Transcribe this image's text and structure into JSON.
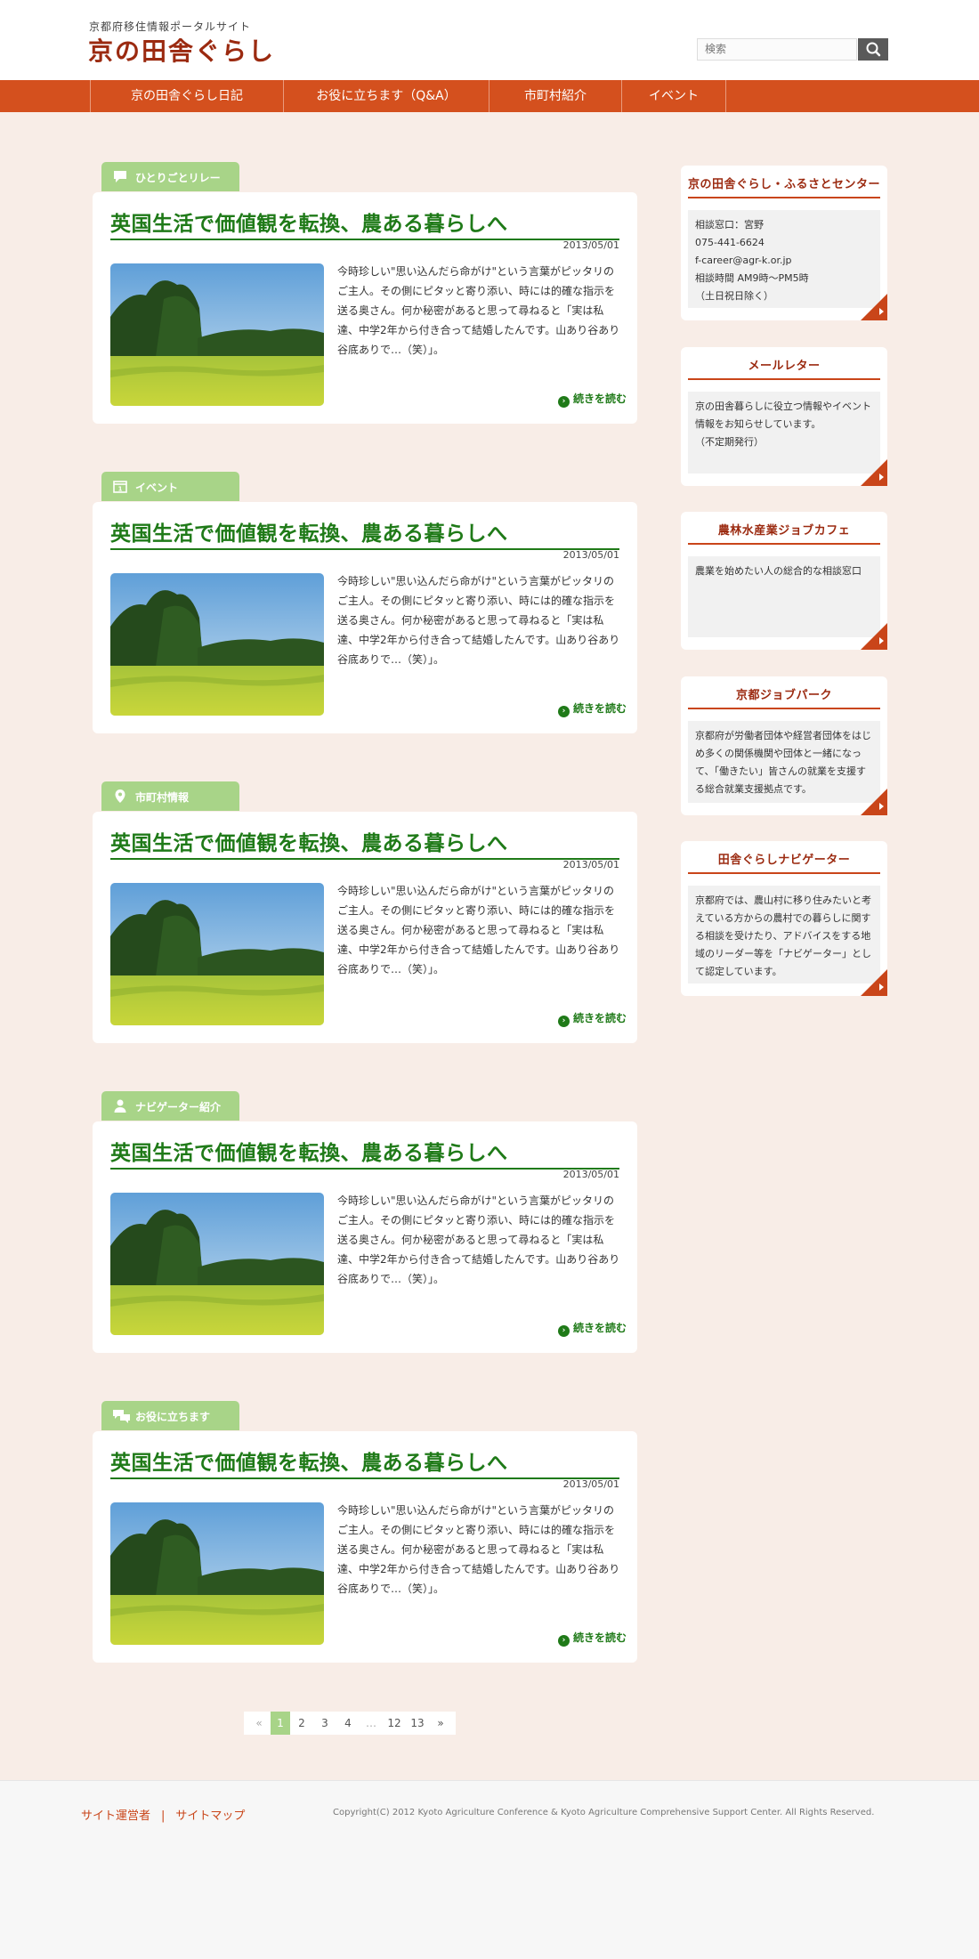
{
  "header": {
    "site_subtitle": "京都府移住情報ポータルサイト",
    "site_title": "京の田舎ぐらし",
    "search_placeholder": "検索"
  },
  "nav": {
    "items": [
      "京の田舎ぐらし日記",
      "お役に立ちます（Q&A）",
      "市町村紹介",
      "イベント"
    ]
  },
  "posts": [
    {
      "category": "ひとりごとリレー",
      "category_icon": "speech-bubble-icon",
      "title": "英国生活で価値観を転換、農ある暮らしへ",
      "date": "2013/05/01",
      "excerpt": "今時珍しい\"思い込んだら命がけ\"という言葉がピッタリのご主人。その側にピタッと寄り添い、時には的確な指示を送る奥さん。何か秘密があると思って尋ねると「実は私達、中学2年から付き合って結婚したんです。山あり谷あり谷底ありで…（笑）」。",
      "more": "続きを読む"
    },
    {
      "category": "イベント",
      "category_icon": "calendar-icon",
      "title": "英国生活で価値観を転換、農ある暮らしへ",
      "date": "2013/05/01",
      "excerpt": "今時珍しい\"思い込んだら命がけ\"という言葉がピッタリのご主人。その側にピタッと寄り添い、時には的確な指示を送る奥さん。何か秘密があると思って尋ねると「実は私達、中学2年から付き合って結婚したんです。山あり谷あり谷底ありで…（笑）」。",
      "more": "続きを読む"
    },
    {
      "category": "市町村情報",
      "category_icon": "map-pin-icon",
      "title": "英国生活で価値観を転換、農ある暮らしへ",
      "date": "2013/05/01",
      "excerpt": "今時珍しい\"思い込んだら命がけ\"という言葉がピッタリのご主人。その側にピタッと寄り添い、時には的確な指示を送る奥さん。何か秘密があると思って尋ねると「実は私達、中学2年から付き合って結婚したんです。山あり谷あり谷底ありで…（笑）」。",
      "more": "続きを読む"
    },
    {
      "category": "ナビゲーター紹介",
      "category_icon": "person-icon",
      "title": "英国生活で価値観を転換、農ある暮らしへ",
      "date": "2013/05/01",
      "excerpt": "今時珍しい\"思い込んだら命がけ\"という言葉がピッタリのご主人。その側にピタッと寄り添い、時には的確な指示を送る奥さん。何か秘密があると思って尋ねると「実は私達、中学2年から付き合って結婚したんです。山あり谷あり谷底ありで…（笑）」。",
      "more": "続きを読む"
    },
    {
      "category": "お役に立ちます",
      "category_icon": "chat-bubbles-icon",
      "title": "英国生活で価値観を転換、農ある暮らしへ",
      "date": "2013/05/01",
      "excerpt": "今時珍しい\"思い込んだら命がけ\"という言葉がピッタリのご主人。その側にピタッと寄り添い、時には的確な指示を送る奥さん。何か秘密があると思って尋ねると「実は私達、中学2年から付き合って結婚したんです。山あり谷あり谷底ありで…（笑）」。",
      "more": "続きを読む"
    }
  ],
  "sidebar": [
    {
      "title": "京の田舎ぐらし・ふるさとセンター",
      "lines": [
        "相談窓口：宮野",
        "075-441-6624",
        "f-career@agr-k.or.jp",
        "相談時間 AM9時～PM5時",
        "（土日祝日除く）"
      ]
    },
    {
      "title": "メールレター",
      "lines": [
        "京の田舎暮らしに役立つ情報やイベント情報をお知らせしています。",
        "（不定期発行）"
      ]
    },
    {
      "title": "農林水産業ジョブカフェ",
      "lines": [
        "農業を始めたい人の総合的な相談窓口"
      ]
    },
    {
      "title": "京都ジョブパーク",
      "lines": [
        "京都府が労働者団体や経営者団体をはじめ多くの関係機関や団体と一緒になって、「働きたい」皆さんの就業を支援する総合就業支援拠点です。"
      ]
    },
    {
      "title": "田舎ぐらしナビゲーター",
      "lines": [
        "京都府では、農山村に移り住みたいと考えている方からの農村での暮らしに関する相談を受けたり、アドバイスをする地域のリーダー等を「ナビゲーター」として認定しています。"
      ]
    }
  ],
  "pagination": {
    "prev": "«",
    "pages": [
      "1",
      "2",
      "3",
      "4",
      "…",
      "12",
      "13"
    ],
    "current": "1",
    "next": "»"
  },
  "footer": {
    "links": [
      "サイト運営者",
      "サイトマップ"
    ],
    "separator": "|",
    "copyright": "Copyright(C) 2012 Kyoto Agriculture Conference & Kyoto Agriculture Comprehensive Support Center. All Rights Reserved."
  },
  "colors": {
    "brand": "#9b2a10",
    "nav": "#d4501e",
    "accent_green": "#1f7a18",
    "tag_green": "#a8d488",
    "background": "#f8ede7"
  }
}
